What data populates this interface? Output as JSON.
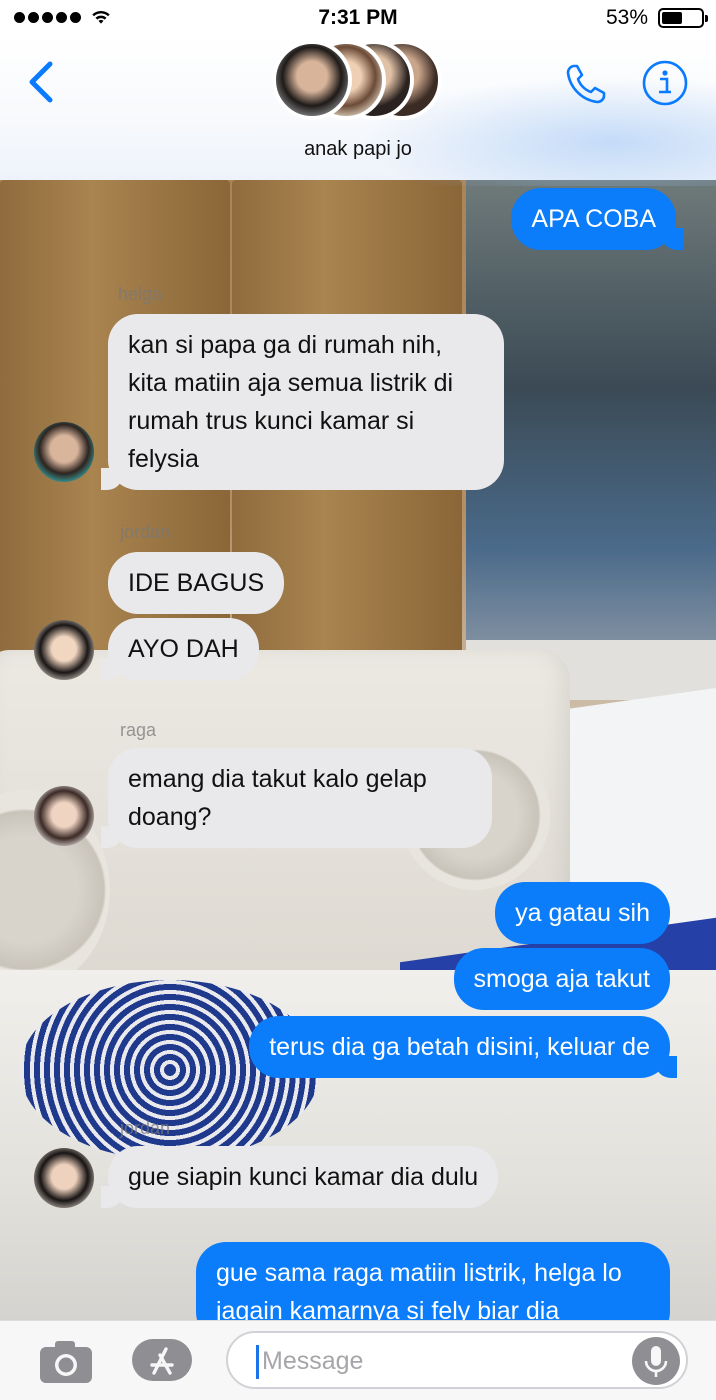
{
  "status_bar": {
    "time": "7:31 PM",
    "battery_percent": "53%",
    "battery_level": 0.53,
    "signal_bars": 5,
    "icons": [
      "signal-icon",
      "wifi-icon",
      "battery-icon"
    ]
  },
  "header": {
    "group_name": "anak papi jo",
    "icons": [
      "back-chevron-icon",
      "phone-icon",
      "info-icon"
    ],
    "accent": "#0a7aff"
  },
  "messages": [
    {
      "direction": "out",
      "text": "APA COBA"
    },
    {
      "direction": "in",
      "sender": "helga",
      "text": "kan si papa ga di rumah nih, kita matiin aja semua listrik di rumah trus kunci kamar si felysia"
    },
    {
      "direction": "in",
      "sender": "jordan",
      "text": "IDE BAGUS"
    },
    {
      "direction": "in",
      "text": "AYO DAH"
    },
    {
      "direction": "in",
      "sender": "raga",
      "text": "emang dia takut kalo gelap doang?"
    },
    {
      "direction": "out",
      "text": "ya gatau sih"
    },
    {
      "direction": "out",
      "text": "smoga aja takut"
    },
    {
      "direction": "out",
      "text": "terus dia ga betah disini, keluar de"
    },
    {
      "direction": "in",
      "sender": "jordan",
      "text": "gue siapin kunci kamar dia dulu"
    },
    {
      "direction": "out",
      "text": "gue sama raga matiin listrik, helga lo jagain kamarnya si fely biar dia"
    }
  ],
  "input_bar": {
    "placeholder": "Message",
    "value": "",
    "icons": [
      "camera-icon",
      "app-store-icon",
      "microphone-icon"
    ]
  },
  "colors": {
    "outgoing_bubble": "#0b7dfb",
    "incoming_bubble": "#e9e9eb",
    "accent": "#0a7aff"
  }
}
